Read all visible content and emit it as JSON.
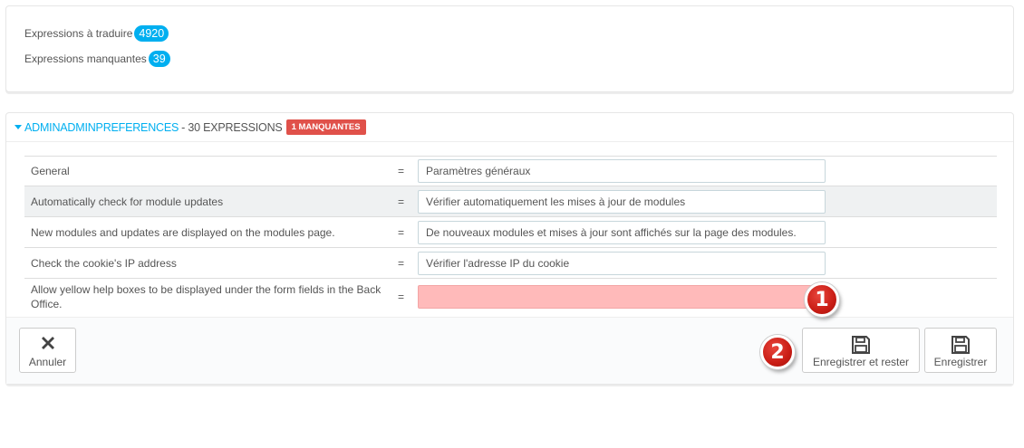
{
  "stats": {
    "to_translate_label": "Expressions à traduire",
    "to_translate_count": "4920",
    "missing_label": "Expressions manquantes",
    "missing_count": "39"
  },
  "section": {
    "name": "ADMINADMINPREFERENCES",
    "count_text": "- 30 EXPRESSIONS",
    "missing_badge": "1 MANQUANTES"
  },
  "rows": [
    {
      "source": "General",
      "eq": "=",
      "translation": "Paramètres généraux"
    },
    {
      "source": "Automatically check for module updates",
      "eq": "=",
      "translation": "Vérifier automatiquement les mises à jour de modules"
    },
    {
      "source": "New modules and updates are displayed on the modules page.",
      "eq": "=",
      "translation": "De nouveaux modules et mises à jour sont affichés sur la page des modules."
    },
    {
      "source": "Check the cookie's IP address",
      "eq": "=",
      "translation": "Vérifier l'adresse IP du cookie"
    },
    {
      "source": "Allow yellow help boxes to be displayed under the form fields in the Back Office.",
      "eq": "=",
      "translation": ""
    }
  ],
  "footer": {
    "cancel_label": "Annuler",
    "save_stay_label": "Enregistrer et rester",
    "save_label": "Enregistrer"
  },
  "markers": {
    "one": "1",
    "two": "2"
  },
  "colors": {
    "accent": "#00aff0",
    "danger": "#e0514a",
    "missing_field": "#ffbaba"
  }
}
